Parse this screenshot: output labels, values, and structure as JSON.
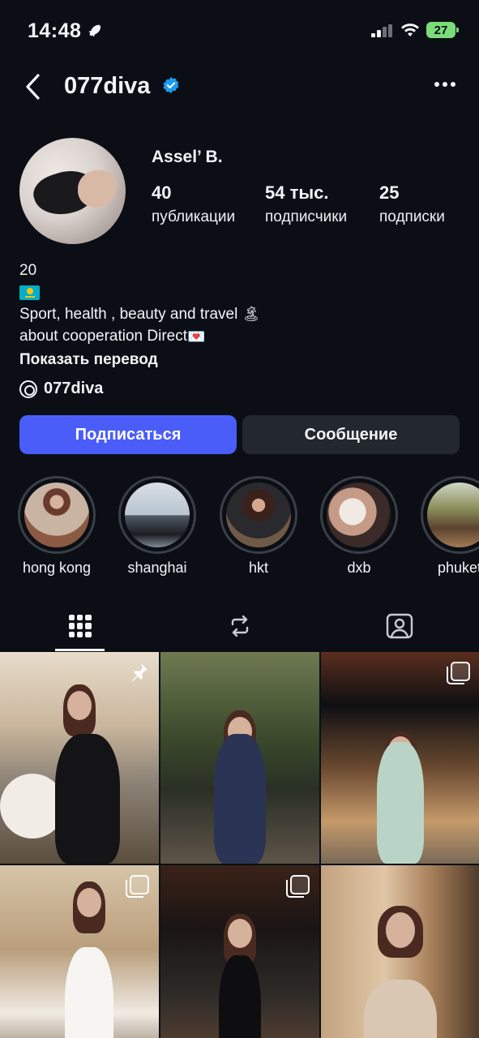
{
  "status_bar": {
    "time": "14:48",
    "battery": "27"
  },
  "header": {
    "username": "077diva"
  },
  "profile": {
    "full_name": "Assel’ B.",
    "stats": [
      {
        "value": "40",
        "label": "публикации"
      },
      {
        "value": "54 тыс.",
        "label": "подписчики"
      },
      {
        "value": "25",
        "label": "подписки"
      }
    ],
    "bio": {
      "line1": "20",
      "line3": "Sport, health , beauty and travel",
      "line4": "about cooperation Direct",
      "show_translation": "Показать перевод"
    },
    "threads_handle": "077diva"
  },
  "actions": {
    "follow": "Подписаться",
    "message": "Сообщение"
  },
  "highlights": [
    {
      "label": "hong kong"
    },
    {
      "label": "shanghai"
    },
    {
      "label": "hkt"
    },
    {
      "label": "dxb"
    },
    {
      "label": "phuket"
    }
  ],
  "tabs": [
    {
      "icon": "grid-icon",
      "active": true
    },
    {
      "icon": "reels-icon",
      "active": false
    },
    {
      "icon": "tagged-icon",
      "active": false
    }
  ],
  "colors": {
    "accent": "#4a5df9",
    "background": "#0b0f15",
    "verified": "#1d9bf0"
  }
}
